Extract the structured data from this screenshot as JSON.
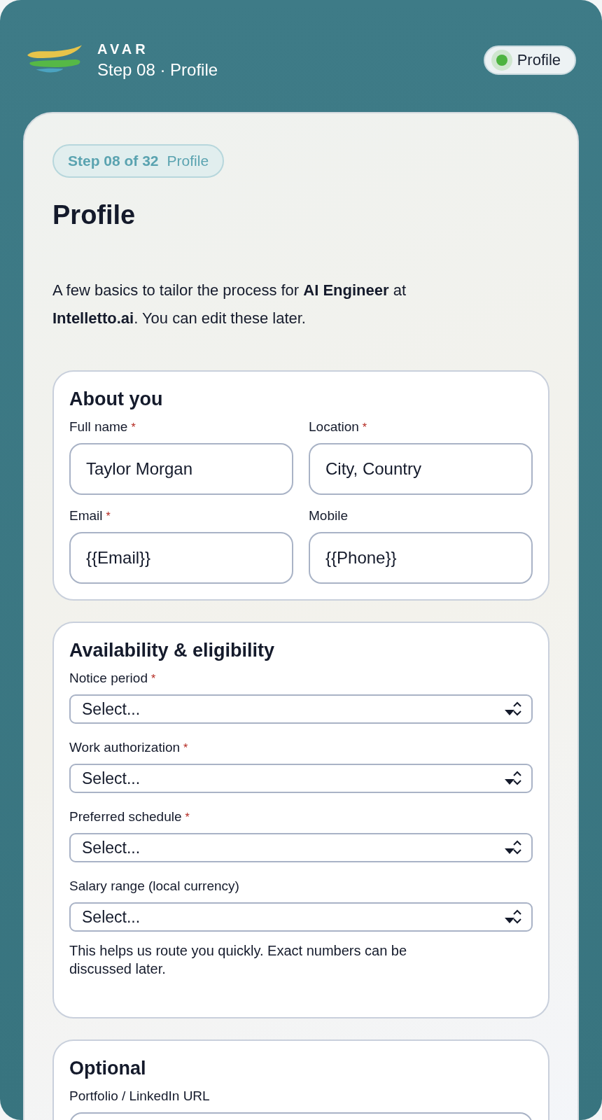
{
  "header": {
    "brand": "AVAR",
    "subtitle": "Step 08 · Profile",
    "status": {
      "label": "Profile",
      "color": "#4cb33f"
    }
  },
  "step_badge": {
    "step": "Step 08 of 32",
    "name": "Profile"
  },
  "title": "Profile",
  "intro": "A few basics to tailor the process for **AI Engineer** at **Intelletto.ai**. You can edit these later.",
  "sections": [
    {
      "title": "About you",
      "kind": "grid",
      "fields": [
        {
          "kind": "text",
          "label": "Full name",
          "required_mark": "*",
          "value": "Taylor Morgan"
        },
        {
          "kind": "text",
          "label": "Location",
          "required_mark": "*",
          "value": "City, Country"
        },
        {
          "kind": "text",
          "label": "Email",
          "required_mark": "*",
          "value": "{{Email}}"
        },
        {
          "kind": "text",
          "label": "Mobile",
          "value": "{{Phone}}"
        }
      ]
    },
    {
      "title": "Availability & eligibility",
      "kind": "stack",
      "fields": [
        {
          "kind": "select",
          "label": "Notice period",
          "required_mark": "*",
          "value": "Select..."
        },
        {
          "kind": "select",
          "label": "Work authorization",
          "required_mark": "*",
          "value": "Select..."
        },
        {
          "kind": "select",
          "label": "Preferred schedule",
          "required_mark": "*",
          "value": "Select..."
        },
        {
          "kind": "select",
          "label": "Salary range (local currency)",
          "value": "Select..."
        }
      ],
      "help": "This helps us route you quickly. Exact numbers can be discussed later."
    },
    {
      "title": "Optional",
      "kind": "stack",
      "fields": [
        {
          "kind": "text",
          "label": "Portfolio / LinkedIn URL"
        }
      ]
    }
  ]
}
